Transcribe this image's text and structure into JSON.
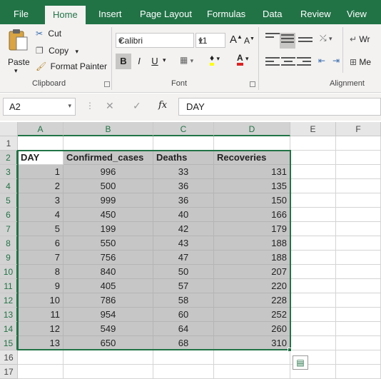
{
  "tabs": [
    "File",
    "Home",
    "Insert",
    "Page Layout",
    "Formulas",
    "Data",
    "Review",
    "View"
  ],
  "active_tab": "Home",
  "clipboard": {
    "paste": "Paste",
    "cut": "Cut",
    "copy": "Copy",
    "format_painter": "Format Painter",
    "group_label": "Clipboard"
  },
  "font": {
    "name": "Calibri",
    "size": "11",
    "bold": "B",
    "italic": "I",
    "underline": "U",
    "group_label": "Font"
  },
  "alignment": {
    "wrap": "Wr",
    "merge": "Me",
    "group_label": "Alignment"
  },
  "formula_bar": {
    "name_box": "A2",
    "fx": "fx",
    "content": "DAY"
  },
  "columns": [
    "A",
    "B",
    "C",
    "D",
    "E",
    "F"
  ],
  "rows": [
    "1",
    "2",
    "3",
    "4",
    "5",
    "6",
    "7",
    "8",
    "9",
    "10",
    "11",
    "12",
    "13",
    "14",
    "15",
    "16",
    "17"
  ],
  "table": {
    "headers": [
      "DAY",
      "Confirmed_cases",
      "Deaths",
      "Recoveries"
    ],
    "rows": [
      [
        "1",
        "996",
        "33",
        "131"
      ],
      [
        "2",
        "500",
        "36",
        "135"
      ],
      [
        "3",
        "999",
        "36",
        "150"
      ],
      [
        "4",
        "450",
        "40",
        "166"
      ],
      [
        "5",
        "199",
        "42",
        "179"
      ],
      [
        "6",
        "550",
        "43",
        "188"
      ],
      [
        "7",
        "756",
        "47",
        "188"
      ],
      [
        "8",
        "840",
        "50",
        "207"
      ],
      [
        "9",
        "405",
        "57",
        "220"
      ],
      [
        "10",
        "786",
        "58",
        "228"
      ],
      [
        "11",
        "954",
        "60",
        "252"
      ],
      [
        "12",
        "549",
        "64",
        "260"
      ],
      [
        "13",
        "650",
        "68",
        "310"
      ]
    ]
  },
  "colors": {
    "brand": "#217346",
    "selection_fill": "#c6c6c6"
  }
}
